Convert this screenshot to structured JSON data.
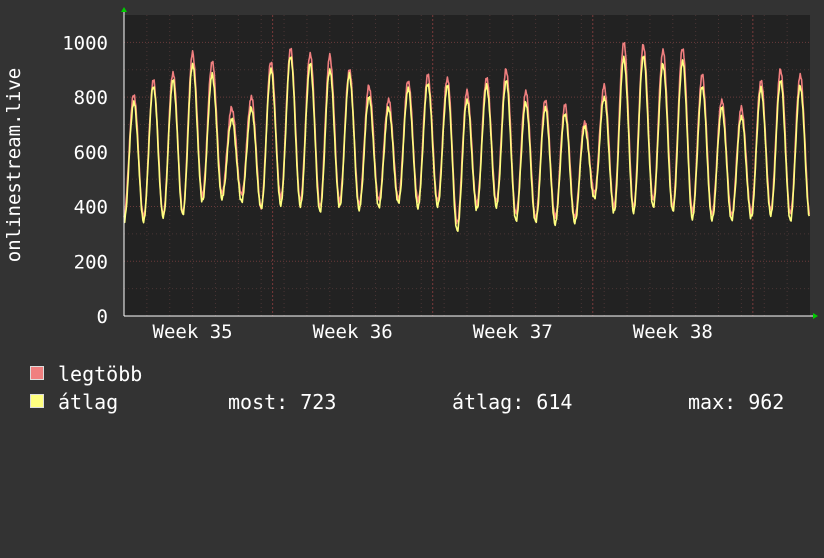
{
  "chart_data": {
    "type": "line",
    "ylabel": "onlinestream.live",
    "ylim": [
      0,
      1100
    ],
    "yticks": [
      0,
      200,
      400,
      600,
      800,
      1000
    ],
    "xlim": [
      0,
      30
    ],
    "x_ticks": [
      {
        "label": "Week 35",
        "value": 3
      },
      {
        "label": "Week 36",
        "value": 10
      },
      {
        "label": "Week 37",
        "value": 17
      },
      {
        "label": "Week 38",
        "value": 24
      }
    ],
    "grid": true,
    "background": "#222222",
    "series": [
      {
        "name": "legtöbb",
        "color": "#f07f7f",
        "peaks": [
          810,
          860,
          890,
          960,
          930,
          760,
          800,
          930,
          975,
          960,
          950,
          900,
          840,
          790,
          860,
          880,
          870,
          820,
          870,
          900,
          820,
          790,
          770,
          710,
          840,
          1000,
          990,
          970,
          980,
          880,
          790,
          760,
          860,
          900,
          880
        ],
        "troughs": [
          370,
          360,
          370,
          380,
          440,
          450,
          440,
          400,
          430,
          420,
          400,
          420,
          410,
          420,
          430,
          420,
          420,
          340,
          410,
          420,
          370,
          360,
          360,
          360,
          450,
          400,
          400,
          420,
          400,
          380,
          370,
          370,
          380,
          390,
          370
        ]
      },
      {
        "name": "átlag",
        "color": "#ffff80",
        "peaks": [
          780,
          840,
          860,
          920,
          880,
          720,
          760,
          900,
          950,
          920,
          900,
          880,
          800,
          760,
          830,
          850,
          840,
          790,
          840,
          860,
          780,
          760,
          740,
          690,
          800,
          940,
          950,
          920,
          930,
          840,
          760,
          730,
          830,
          860,
          840
        ],
        "troughs": [
          340,
          350,
          360,
          370,
          420,
          430,
          420,
          390,
          410,
          400,
          380,
          400,
          390,
          400,
          410,
          400,
          400,
          310,
          390,
          400,
          350,
          340,
          340,
          340,
          430,
          380,
          380,
          400,
          380,
          360,
          350,
          350,
          360,
          370,
          350
        ]
      }
    ]
  },
  "legend": [
    {
      "label": "legtöbb",
      "color": "#f07f7f"
    },
    {
      "label": "átlag",
      "color": "#ffff80"
    }
  ],
  "stats": {
    "most": "most: 723",
    "avg": "átlag: 614",
    "max": "max: 962"
  }
}
